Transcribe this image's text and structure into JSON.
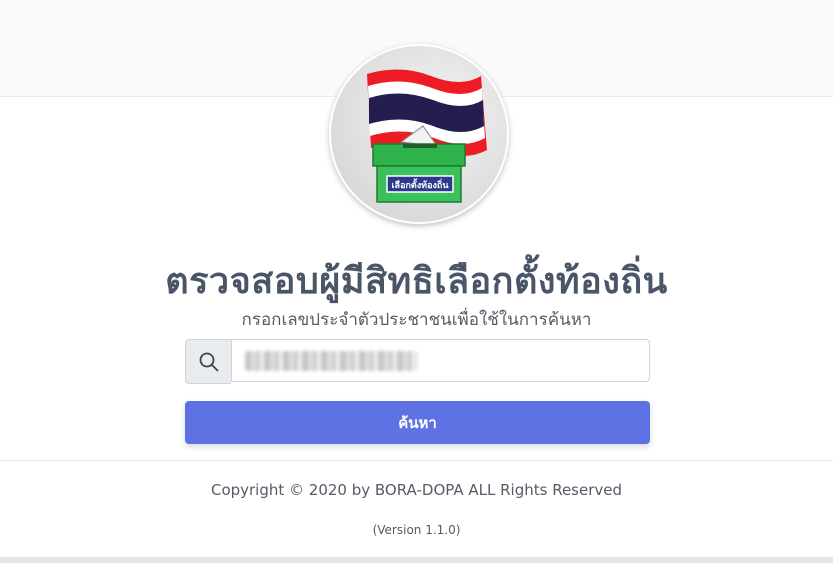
{
  "logo": {
    "ballot_box_label": "เลือกตั้งท้องถิ่น",
    "flag_colors": [
      "#ED1C24",
      "#FFFFFF",
      "#241D4F"
    ],
    "box_color": "#2EB34A"
  },
  "header": {
    "title": "ตรวจสอบผู้มีสิทธิเลือกตั้งท้องถิ่น",
    "subtitle": "กรอกเลขประจำตัวประชาชนเพื่อใช้ในการค้นหา"
  },
  "search": {
    "icon": "search-icon",
    "value": "",
    "button_label": "ค้นหา",
    "button_color": "#5F72E4"
  },
  "footer": {
    "copyright": "Copyright © 2020 by BORA-DOPA ALL Rights Reserved",
    "version": "(Version 1.1.0)"
  }
}
